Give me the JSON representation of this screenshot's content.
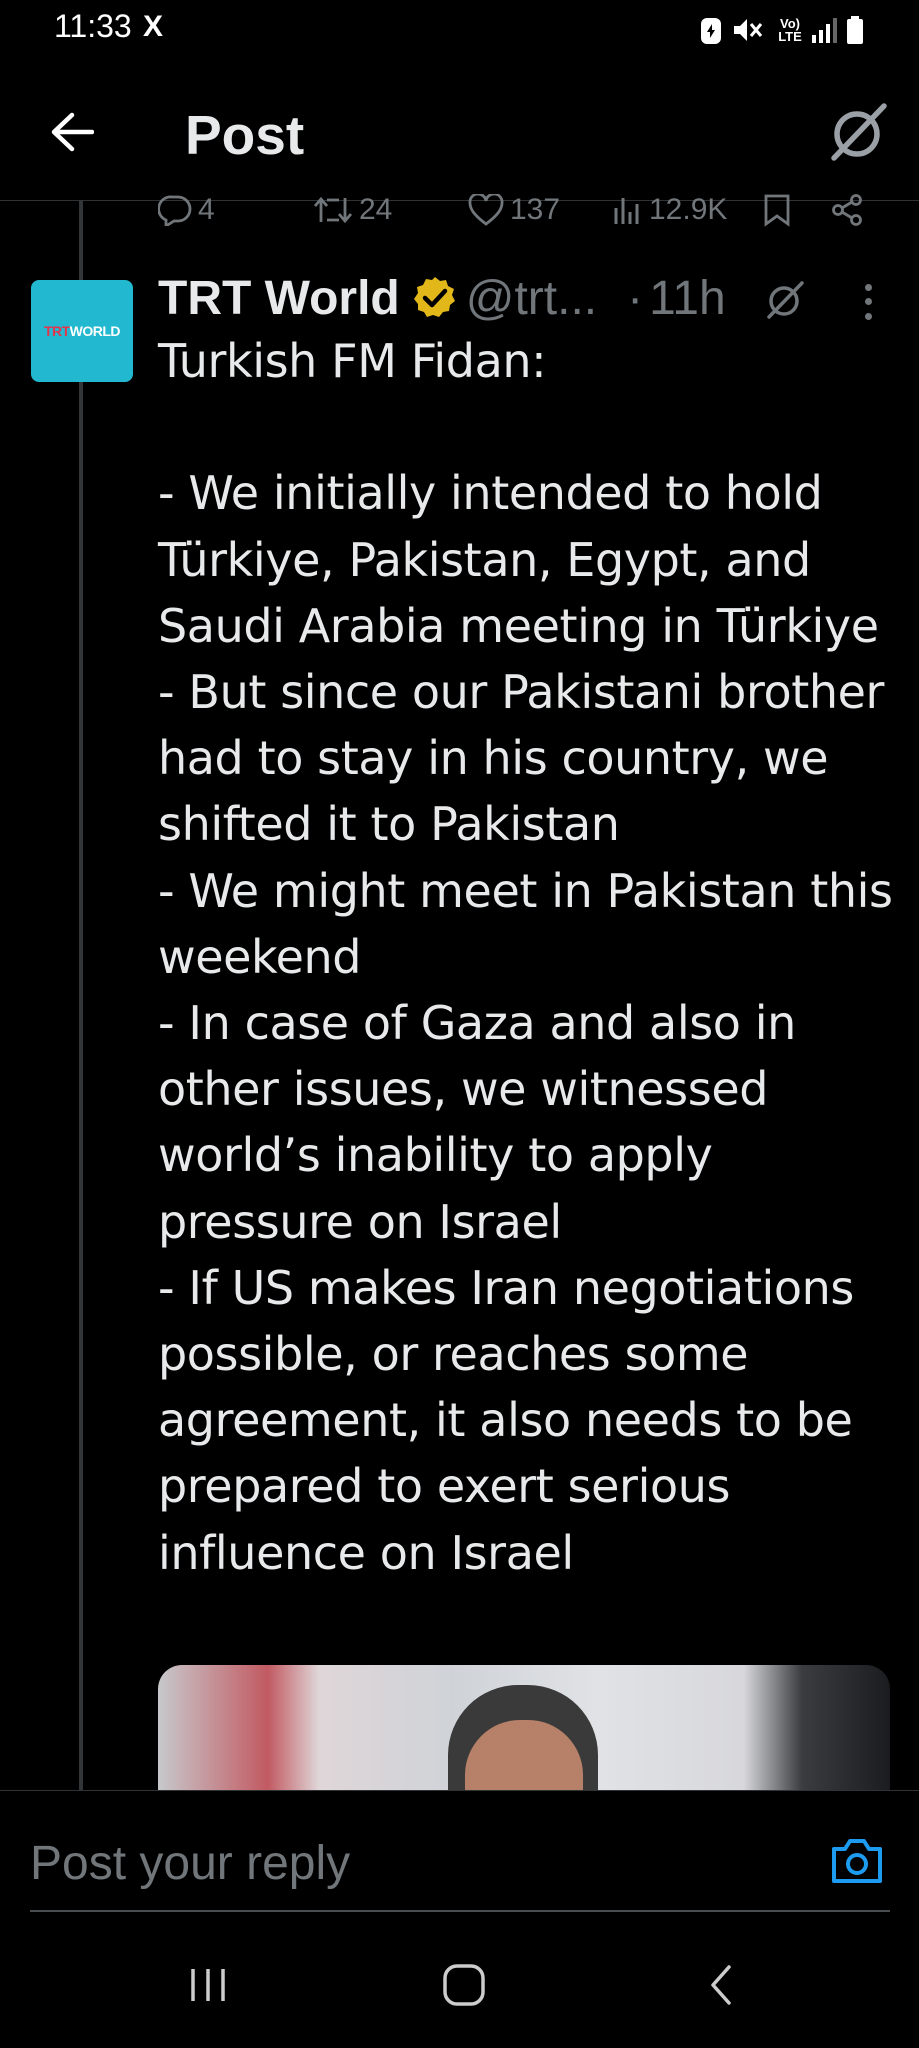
{
  "status_bar": {
    "time": "11:33",
    "app_icon": "X",
    "network": "Vo) LTE"
  },
  "header": {
    "title": "Post",
    "back_icon": "arrow-left-icon",
    "grok_icon": "grok-icon"
  },
  "prev_tweet_actions": {
    "replies": "4",
    "reposts": "24",
    "likes": "137",
    "views": "12.9K"
  },
  "tweet": {
    "avatar_text_red": "TRT",
    "avatar_text_white": "WORLD",
    "author_name": "TRT World",
    "handle": "@trt...",
    "separator": "·",
    "time": "11h",
    "text": "Turkish FM Fidan:\n\n- We initially intended to hold Türkiye, Pakistan, Egypt, and Saudi Arabia meeting in Türkiye\n- But since our Pakistani brother had to stay in his country, we shifted it to Pakistan\n- We might meet in Pakistan this weekend\n- In case of Gaza and also in other issues, we witnessed world’s inability to apply pressure on Israel\n- If US makes Iran negotiations possible, or reaches some agreement, it also needs to be prepared to exert serious influence on Israel"
  },
  "reply": {
    "placeholder": "Post your reply"
  },
  "colors": {
    "background": "#000000",
    "text": "#e7e9ea",
    "muted": "#71767b",
    "accent": "#1d9bf0",
    "verified": "#e2b719",
    "avatar": "#22b8cf"
  }
}
